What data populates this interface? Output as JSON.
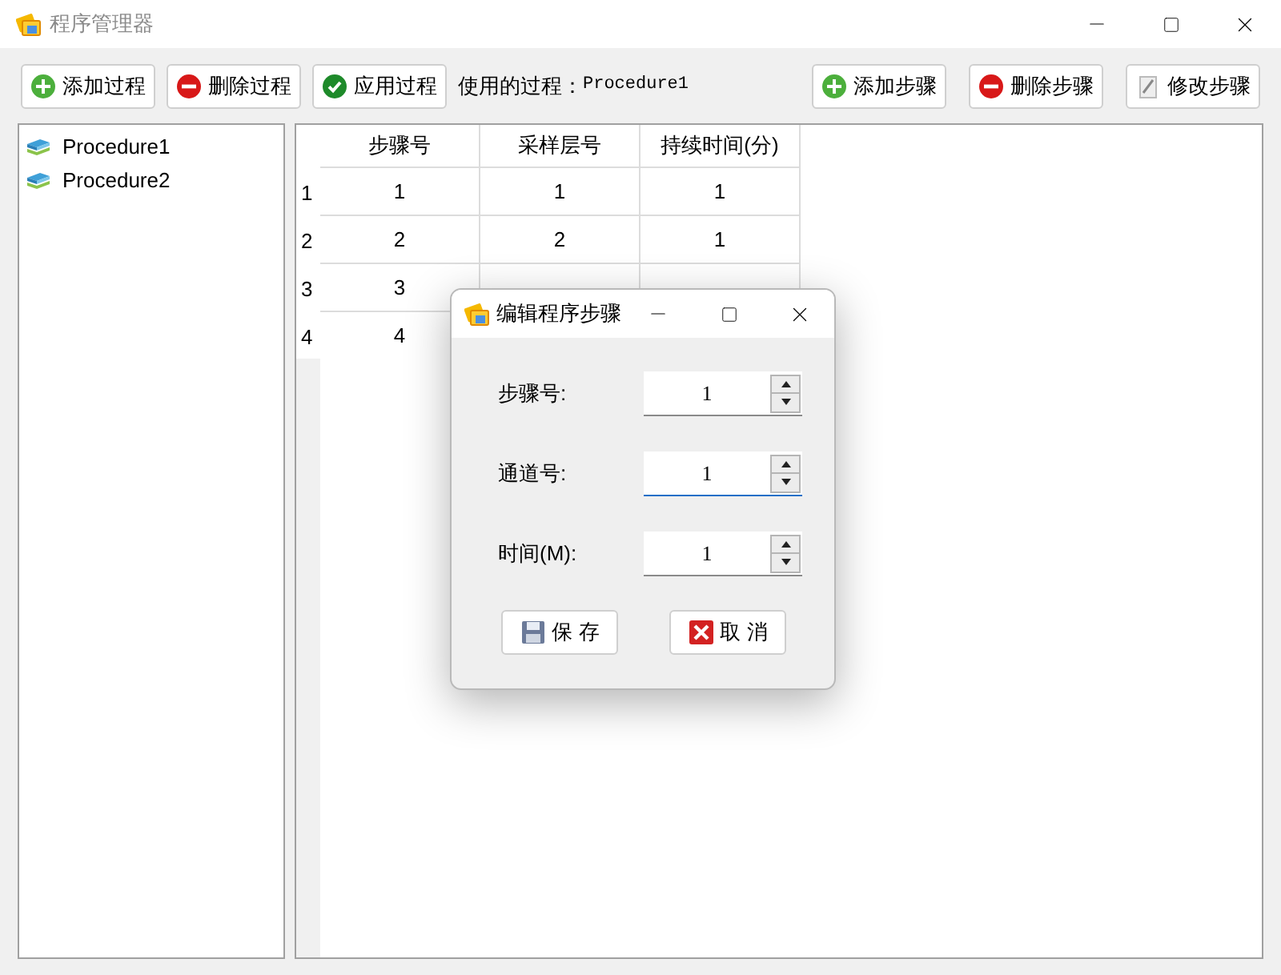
{
  "window": {
    "title": "程序管理器"
  },
  "toolbar": {
    "left_buttons": [
      {
        "label": "添加过程",
        "kind": "add"
      },
      {
        "label": "删除过程",
        "kind": "remove"
      },
      {
        "label": "应用过程",
        "kind": "apply"
      }
    ],
    "current_label": "使用的过程：",
    "current_value": "Procedure1",
    "right_buttons": [
      {
        "label": "添加步骤",
        "kind": "add"
      },
      {
        "label": "删除步骤",
        "kind": "remove"
      },
      {
        "label": "修改步骤",
        "kind": "edit"
      }
    ]
  },
  "procedures": [
    {
      "name": "Procedure1"
    },
    {
      "name": "Procedure2"
    }
  ],
  "table": {
    "columns": [
      "步骤号",
      "采样层号",
      "持续时间(分)"
    ],
    "rows": [
      {
        "index": "1",
        "cells": [
          "1",
          "1",
          "1"
        ]
      },
      {
        "index": "2",
        "cells": [
          "2",
          "2",
          "1"
        ]
      },
      {
        "index": "3",
        "cells": [
          "3"
        ]
      },
      {
        "index": "4",
        "cells": [
          "4"
        ]
      }
    ]
  },
  "dialog": {
    "title": "编辑程序步骤",
    "fields": [
      {
        "label": "步骤号:",
        "value": "1",
        "focused": false
      },
      {
        "label": "通道号:",
        "value": "1",
        "focused": true
      },
      {
        "label": "时间(M):",
        "value": "1",
        "focused": false
      }
    ],
    "buttons": [
      {
        "label": "保 存",
        "kind": "save"
      },
      {
        "label": "取 消",
        "kind": "cancel"
      }
    ]
  }
}
